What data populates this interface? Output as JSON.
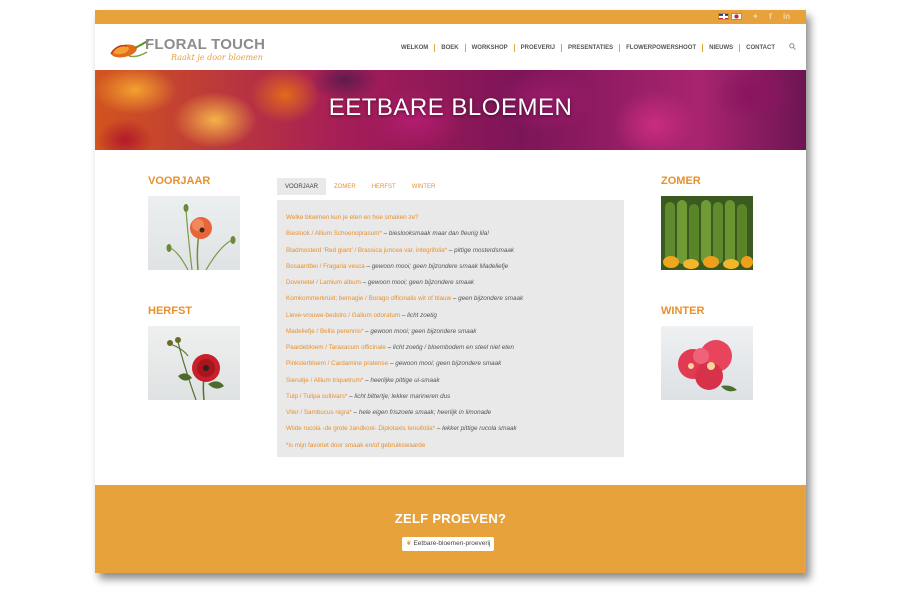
{
  "brand": {
    "name": "FLORAL TOUCH",
    "tagline": "Raakt je door bloemen"
  },
  "nav": {
    "items": [
      "WELKOM",
      "BOEK",
      "WORKSHOP",
      "PROEVERIJ",
      "PRESENTATIES",
      "FLOWERPOWERSHOOT",
      "NIEUWS",
      "CONTACT"
    ]
  },
  "social": [
    "twitter-icon",
    "facebook-icon",
    "linkedin-icon"
  ],
  "hero": {
    "title": "EETBARE BLOEMEN"
  },
  "seasons": {
    "left_top": "VOORJAAR",
    "left_bottom": "HERFST",
    "right_top": "ZOMER",
    "right_bottom": "WINTER"
  },
  "tabs": [
    "VOORJAAR",
    "ZOMER",
    "HERFST",
    "WINTER"
  ],
  "content": {
    "question": "Welke bloemen kun je eten en hoe smaken ze?",
    "rows": [
      {
        "name": "Bieslook / Allium Schoenoprasum*",
        "desc": "bieslooksmaak maar dan fleurig lila!"
      },
      {
        "name": "Bladmosterd ‘Red giant’ / Brassica juncea var. integrifolia*",
        "desc": "pittige mosterdsmaak"
      },
      {
        "name": "Bosaardbei / Fragaria vesca",
        "desc": "gewoon mooi; geen bijzondere smaak Madeliefje"
      },
      {
        "name": "Dovenetel / Lamium album",
        "desc": "gewoon mooi; geen bijzondere smaak"
      },
      {
        "name": "Komkommerkruid; bernagie / Borago officinalis wit of blauw",
        "desc": "geen bijzondere smaak"
      },
      {
        "name": "Lieve-vrouwe-bedstro / Galium odoratum",
        "desc": "licht zoetig"
      },
      {
        "name": "Madeliefje / Bellis perennis*",
        "desc": "gewoon mooi; geen bijzondere smaak"
      },
      {
        "name": "Paardebloem / Taraxacum officinale",
        "desc": "licht zoetig / bloembodem en steel niet eten"
      },
      {
        "name": "Pinksterbloem / Cardamine pratense",
        "desc": "gewoon mooi; geen bijzondere smaak"
      },
      {
        "name": "Sieruitje / Allium triquetrum*",
        "desc": "heerlijke pittige ui-smaak"
      },
      {
        "name": "Tulp / Tulipa cultivars*",
        "desc": "licht bittertje; lekker marineren dus"
      },
      {
        "name": "Vlier / Sambucus nigra*",
        "desc": "hele eigen friszoete smaak; heerlijk in limonade"
      },
      {
        "name": "Wilde rucola -de grote zandkool- Diplotaxis tenuifolia*",
        "desc": "lekker pittige rucola smaak"
      }
    ],
    "footnote": "*is mijn favoriet door smaak en/of gebruikswaarde",
    "separator": " – "
  },
  "footer": {
    "title": "ZELF PROEVEN?",
    "button_label": "Eetbare-bloemen-proeverij"
  },
  "colors": {
    "accent": "#e8a23c",
    "link": "#e8902e",
    "panel": "#e9e9e9"
  }
}
